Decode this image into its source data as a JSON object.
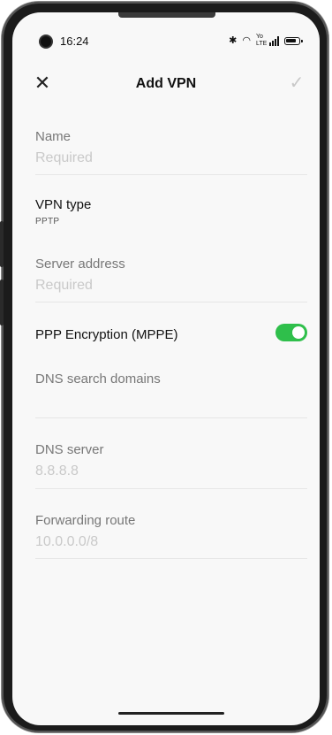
{
  "status": {
    "time": "16:24",
    "bluetooth_icon": "bluetooth-icon",
    "wifi_icon": "wifi-icon",
    "volte_label": "Yo LTE",
    "signal_icon": "signal-icon",
    "battery_icon": "battery-icon"
  },
  "header": {
    "title": "Add VPN",
    "close_icon": "close-icon",
    "confirm_icon": "check-icon"
  },
  "form": {
    "name": {
      "label": "Name",
      "placeholder": "Required"
    },
    "vpn_type": {
      "label": "VPN type",
      "value": "PPTP"
    },
    "server": {
      "label": "Server address",
      "placeholder": "Required"
    },
    "mppe": {
      "label": "PPP Encryption (MPPE)",
      "enabled": true
    },
    "dns_domains": {
      "label": "DNS search domains",
      "value": ""
    },
    "dns_server": {
      "label": "DNS server",
      "placeholder": "8.8.8.8"
    },
    "forwarding": {
      "label": "Forwarding route",
      "placeholder": "10.0.0.0/8"
    }
  },
  "colors": {
    "toggle_on": "#2fbf4b",
    "background": "#f8f8f8"
  }
}
